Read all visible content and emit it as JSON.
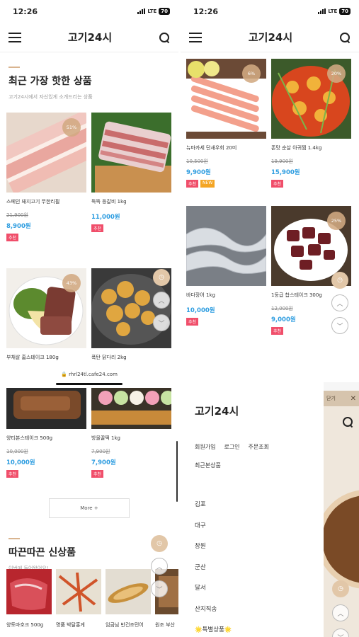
{
  "status": {
    "time": "12:26",
    "network": "LTE",
    "battery": "70"
  },
  "header": {
    "logo": "고기24시"
  },
  "best": {
    "title": "최근 가장 핫한 상품",
    "subtitle": "고기24시에서 자신있게 소개드리는 상품",
    "products": [
      {
        "name": "스페인 돼지고기 무한리필",
        "discount": "51%",
        "original": "21,900원",
        "price": "8,900원",
        "badges": [
          "추천"
        ]
      },
      {
        "name": "뚝뚝 등갈비 1kg",
        "discount": "",
        "original": "",
        "price": "11,000원",
        "badges": [
          "추천"
        ]
      },
      {
        "name": "부채살 홈스테이크 180g",
        "discount": "43%",
        "original": "",
        "price": "",
        "badges": []
      },
      {
        "name": "폭탄 닭다리 2kg",
        "discount": "",
        "original": "",
        "price": "",
        "badges": []
      }
    ]
  },
  "best2": {
    "products": [
      {
        "name": "뉴마카세 단새우회 20미",
        "discount": "6%",
        "original": "10,500원",
        "price": "9,900원",
        "badges": [
          "추천",
          "NEW"
        ]
      },
      {
        "name": "존맛 순살 아귀찜 1.4kg",
        "discount": "20%",
        "original": "19,900원",
        "price": "15,900원",
        "badges": [
          "추천"
        ]
      },
      {
        "name": "바다장어 1kg",
        "discount": "",
        "original": "",
        "price": "10,000원",
        "badges": [
          "추천"
        ]
      },
      {
        "name": "1등급 찹스테이크 300g",
        "discount": "25%",
        "original": "12,000원",
        "price": "9,000원",
        "badges": [
          "추천"
        ]
      }
    ]
  },
  "best3": {
    "products": [
      {
        "name": "양티본스테이크 500g",
        "original": "10,000원",
        "price": "10,000원",
        "badges": [
          "추천"
        ]
      },
      {
        "name": "방울꿀떡 1kg",
        "original": "7,900원",
        "price": "7,900원",
        "badges": [
          "추천"
        ]
      }
    ],
    "more": "More +"
  },
  "newp": {
    "title": "따끈따끈 신상품",
    "subtitle": "이번에 들어왔어요!",
    "items": [
      "양토마호크 500g",
      "명품 박달홍게",
      "임금님 반건조민어",
      "원조 부산"
    ]
  },
  "browser": {
    "url": "rhrl24tl.cafe24.com"
  },
  "menu": {
    "logo": "고기24시",
    "links": [
      "회원가입",
      "로그인",
      "주문조회"
    ],
    "recent": "최근본상품",
    "categories": [
      "김포",
      "대구",
      "창원",
      "군산",
      "달서",
      "산지직송",
      "🌟특별상품🌟"
    ],
    "close": "✕",
    "close_label": "닫기"
  },
  "colors": {
    "accent": "#2e9de0",
    "badge": "#f04e6a",
    "new": "#f4a524",
    "discount": "#d2aa82"
  }
}
